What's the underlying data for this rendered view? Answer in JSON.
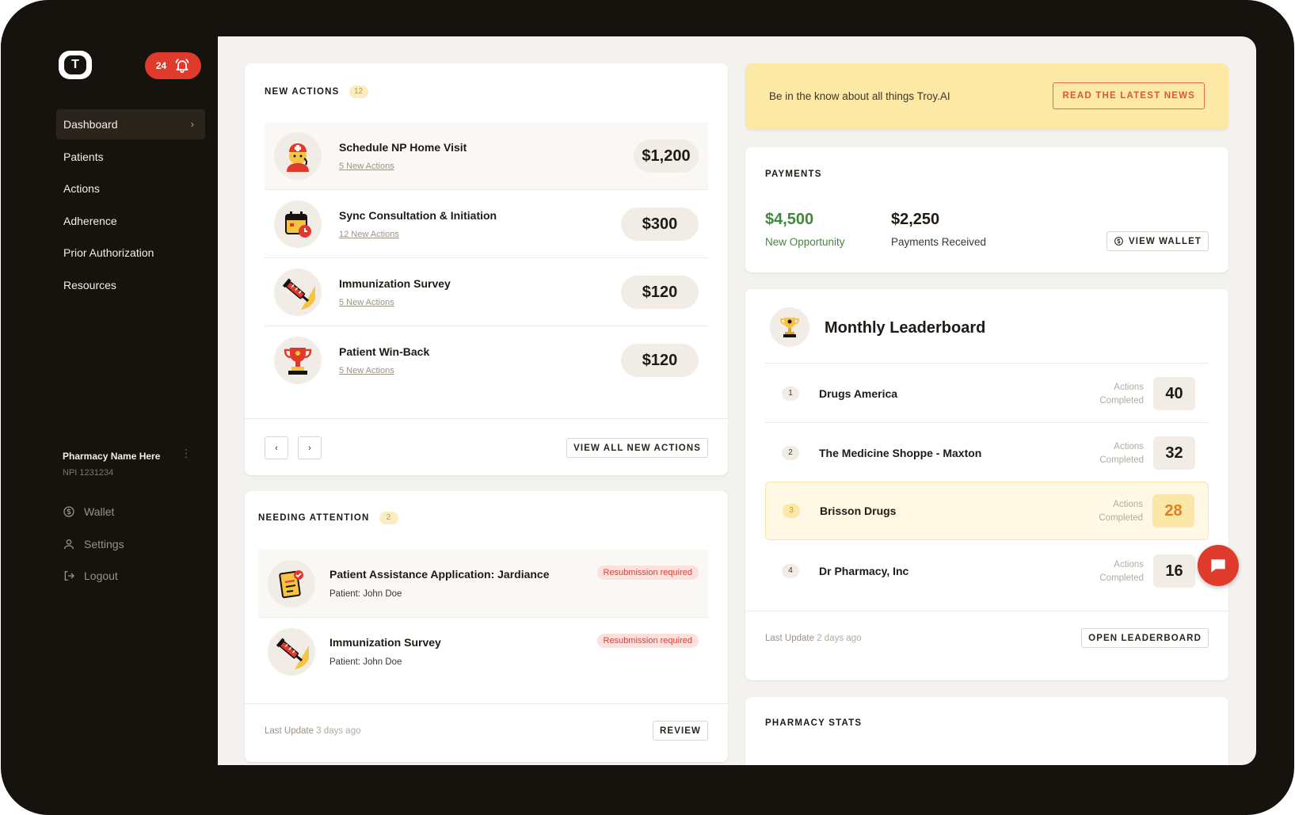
{
  "sidebar": {
    "logo_letter": "T",
    "notifications_count": "24",
    "nav": [
      {
        "label": "Dashboard",
        "active": true
      },
      {
        "label": "Patients"
      },
      {
        "label": "Actions"
      },
      {
        "label": "Adherence"
      },
      {
        "label": "Prior Authorization"
      },
      {
        "label": "Resources"
      }
    ],
    "pharmacy": {
      "name": "Pharmacy Name Here",
      "npi": "NPI 1231234"
    },
    "sub_nav": [
      {
        "label": "Wallet",
        "icon": "wallet-icon"
      },
      {
        "label": "Settings",
        "icon": "user-icon"
      },
      {
        "label": "Logout",
        "icon": "logout-icon"
      }
    ]
  },
  "new_actions": {
    "title": "NEW ACTIONS",
    "count": "12",
    "items": [
      {
        "title": "Schedule NP Home Visit",
        "sub": "5 New Actions",
        "price": "$1,200",
        "icon": "nurse-icon"
      },
      {
        "title": "Sync Consultation & Initiation",
        "sub": "12 New Actions",
        "price": "$300",
        "icon": "calendar-clock-icon"
      },
      {
        "title": "Immunization Survey",
        "sub": "5 New Actions",
        "price": "$120",
        "icon": "syringe-icon"
      },
      {
        "title": "Patient Win-Back",
        "sub": "5 New Actions",
        "price": "$120",
        "icon": "trophy-icon"
      }
    ],
    "prev": "‹",
    "next": "›",
    "view_all": "VIEW ALL NEW ACTIONS"
  },
  "needing_attention": {
    "title": "NEEDING ATTENTION",
    "count": "2",
    "items": [
      {
        "title": "Patient Assistance Application: Jardiance",
        "patient": "Patient: John Doe",
        "status": "Resubmission required",
        "icon": "document-check-icon"
      },
      {
        "title": "Immunization Survey",
        "patient": "Patient: John Doe",
        "status": "Resubmission required",
        "icon": "syringe-icon"
      }
    ],
    "last_update_label": "Last Update",
    "last_update_value": "3 days ago",
    "review": "REVIEW"
  },
  "news": {
    "text": "Be in the know about all things Troy.AI",
    "button": "READ THE LATEST NEWS"
  },
  "payments": {
    "title": "PAYMENTS",
    "opportunity_value": "$4,500",
    "opportunity_label": "New Opportunity",
    "received_value": "$2,250",
    "received_label": "Payments Received",
    "wallet_button": "VIEW WALLET",
    "opportunity_color": "#3f8a3a"
  },
  "leaderboard": {
    "title": "Monthly Leaderboard",
    "actions_label_1": "Actions",
    "actions_label_2": "Completed",
    "rows": [
      {
        "rank": "1",
        "name": "Drugs America",
        "score": "40"
      },
      {
        "rank": "2",
        "name": "The Medicine Shoppe - Maxton",
        "score": "32"
      },
      {
        "rank": "3",
        "name": "Brisson Drugs",
        "score": "28",
        "highlight": true
      },
      {
        "rank": "4",
        "name": "Dr Pharmacy, Inc",
        "score": "16"
      }
    ],
    "last_update_label": "Last Update",
    "last_update_value": "2 days ago",
    "open_button": "OPEN LEADERBOARD"
  },
  "pharmacy_stats": {
    "title": "PHARMACY STATS"
  },
  "colors": {
    "accent_red": "#e03a2c",
    "banner_yellow": "#fde9a6",
    "highlight_orange": "#e07f1e"
  }
}
